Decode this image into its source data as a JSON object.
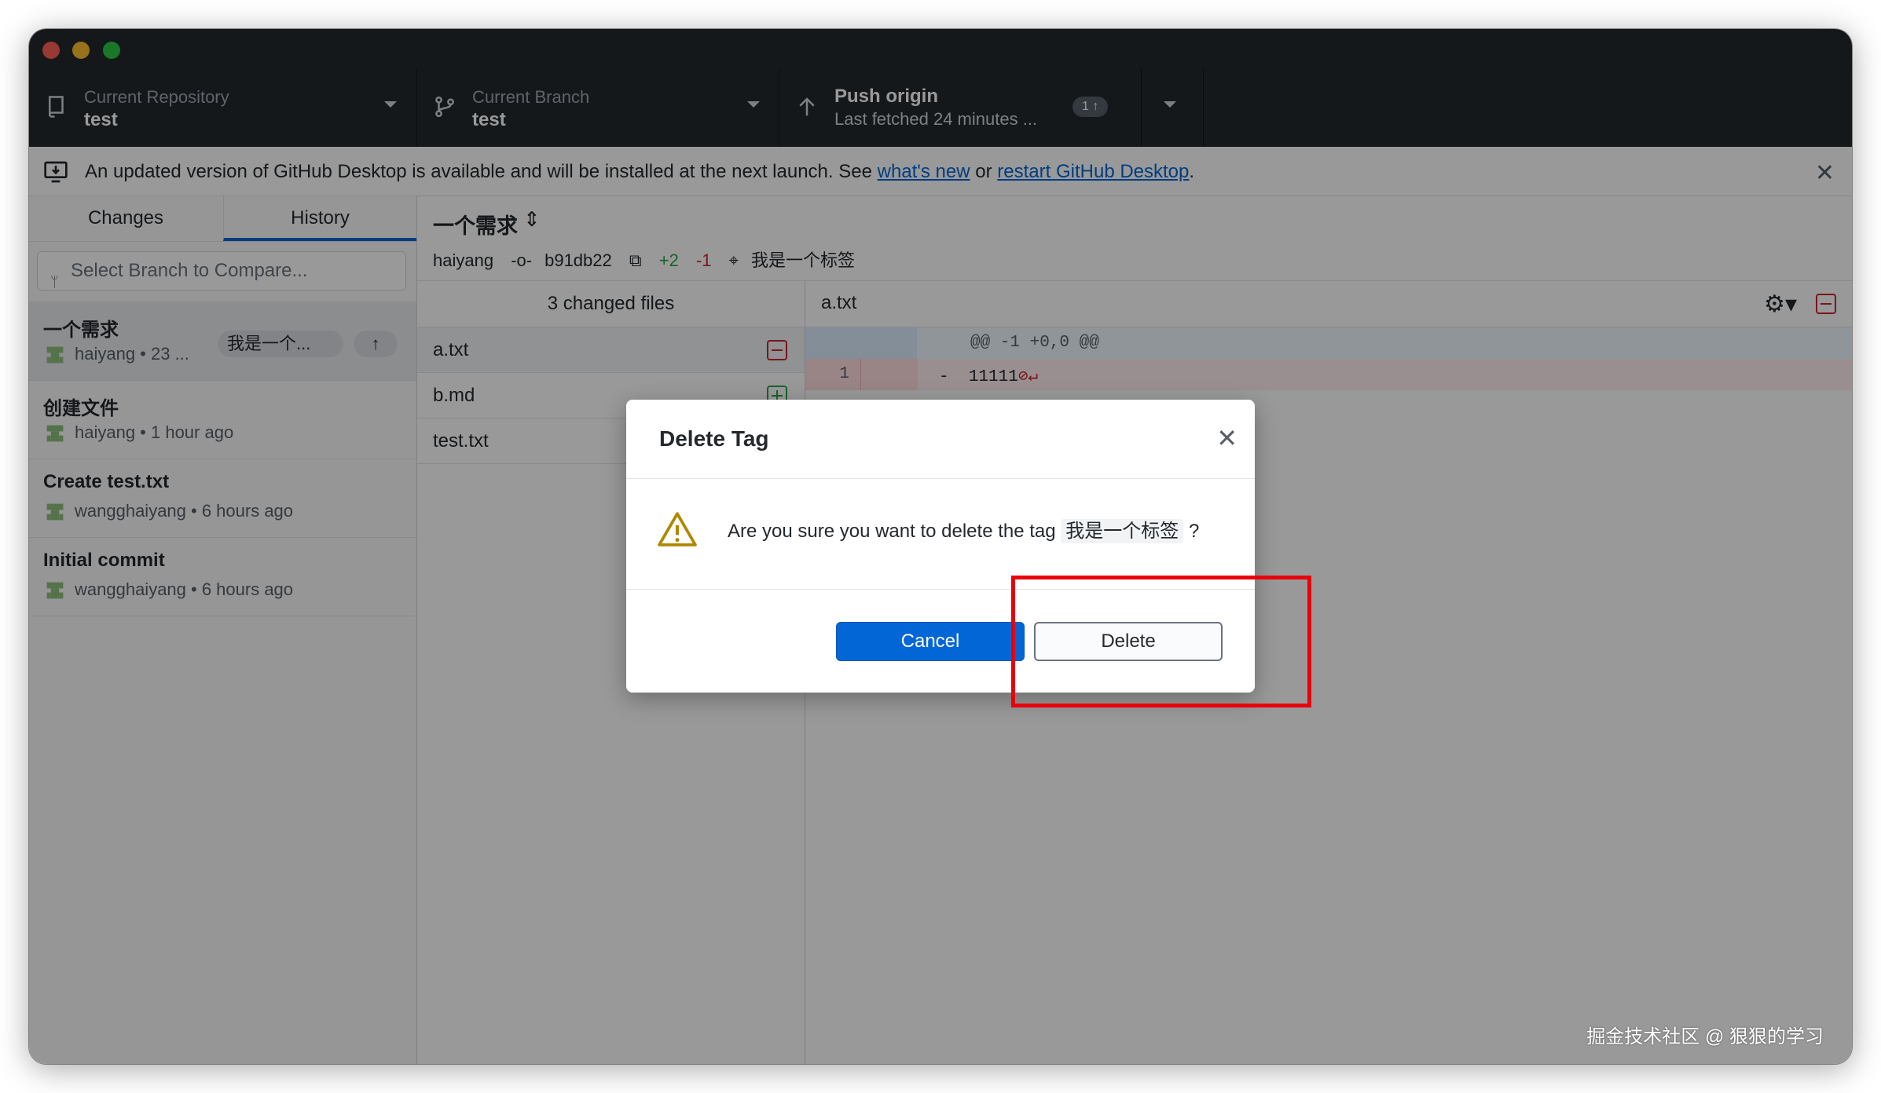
{
  "toolbar": {
    "repo_label": "Current Repository",
    "repo_name": "test",
    "branch_label": "Current Branch",
    "branch_name": "test",
    "push_title": "Push origin",
    "push_subtitle": "Last fetched 24 minutes ...",
    "push_badge": "1 ↑"
  },
  "banner": {
    "text": "An updated version of GitHub Desktop is available and will be installed at the next launch. See ",
    "link1": "what's new",
    "mid": " or ",
    "link2": "restart GitHub Desktop",
    "end": "."
  },
  "sidebar": {
    "tab_changes": "Changes",
    "tab_history": "History",
    "compare_placeholder": "Select Branch to Compare...",
    "commits": [
      {
        "title": "一个需求",
        "meta": "haiyang • 23 ...",
        "tag": "我是一个...",
        "up": "↑"
      },
      {
        "title": "创建文件",
        "meta": "haiyang • 1 hour ago"
      },
      {
        "title": "Create test.txt",
        "meta": "wangghaiyang • 6 hours ago"
      },
      {
        "title": "Initial commit",
        "meta": "wangghaiyang • 6 hours ago"
      }
    ]
  },
  "commit_header": {
    "title": "一个需求",
    "author": "haiyang",
    "sha": "b91db22",
    "additions": "+2",
    "deletions": "-1",
    "tag": "我是一个标签"
  },
  "files": {
    "header": "3 changed files",
    "items": [
      {
        "name": "a.txt",
        "status": "deleted"
      },
      {
        "name": "b.md",
        "status": "added"
      },
      {
        "name": "test.txt",
        "status": "modified"
      }
    ]
  },
  "diff": {
    "filename": "a.txt",
    "hunk": "@@ -1 +0,0 @@",
    "line_number": "1",
    "line_sign": "-",
    "line_text": "11111",
    "no_newline_marker": "⊘↵"
  },
  "dialog": {
    "title": "Delete Tag",
    "message": "Are you sure you want to delete the tag",
    "tag_name": "我是一个标签",
    "question_mark": "?",
    "cancel_label": "Cancel",
    "delete_label": "Delete"
  },
  "watermark": "掘金技术社区 @ 狠狠的学习",
  "colors": {
    "accent": "#0366d6",
    "toolbar_bg": "#24292e",
    "deleted": "#cb2431",
    "added": "#28a745",
    "highlight": "#e8000b"
  }
}
